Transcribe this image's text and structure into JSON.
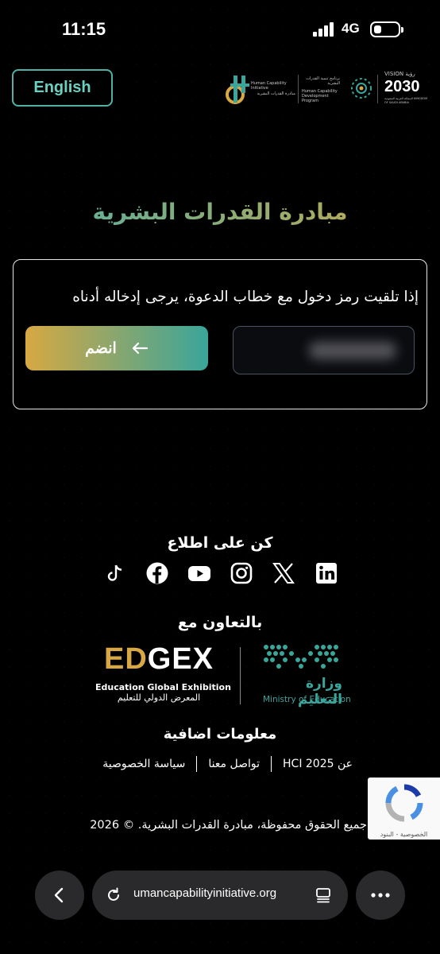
{
  "status": {
    "time": "11:15",
    "network": "4G"
  },
  "header": {
    "language_button": "English",
    "logos": {
      "hci_en": "Human Capability Initiative",
      "hci_ar": "مبادرة القدرات البشرية",
      "hcdp_ar": "برنامج تنمية القدرات البشرية",
      "hcdp_en": "Human Capability Development Program",
      "vision_label": "VISION رؤية",
      "vision_year": "2030",
      "vision_sub": "المملكة العربية السعودية KINGDOM OF SAUDI ARABIA"
    }
  },
  "main": {
    "title": "مبادرة القدرات البشرية",
    "instruction": "إذا تلقيت رمز دخول مع خطاب الدعوة، يرجى إدخاله أدناه",
    "code_placeholder": "",
    "join_label": "انضم"
  },
  "footer": {
    "follow_title": "كن على اطلاع",
    "socials": [
      "tiktok-icon",
      "facebook-icon",
      "youtube-icon",
      "instagram-icon",
      "x-icon",
      "linkedin-icon"
    ],
    "partners_title": "بالتعاون مع",
    "edgex": {
      "logo": "EDGEX",
      "en": "Education Global Exhibition",
      "ar": "المعرض الدولي للتعليم"
    },
    "moe": {
      "ar": "وزارة التعليم",
      "en": "Ministry of Education"
    },
    "more_info_title": "معلومات اضافية",
    "links": [
      "عن HCI 2025",
      "تواصل معنا",
      "سياسة الخصوصية"
    ],
    "copyright": "جميع الحقوق محفوظة، مبادرة القدرات البشرية. © 2026"
  },
  "recaptcha": {
    "label": "الخصوصية - البنود"
  },
  "browser": {
    "url": "umancapabilityinitiative.org"
  },
  "colors": {
    "accent_teal": "#4fb1a6",
    "accent_gold": "#d7a843"
  }
}
